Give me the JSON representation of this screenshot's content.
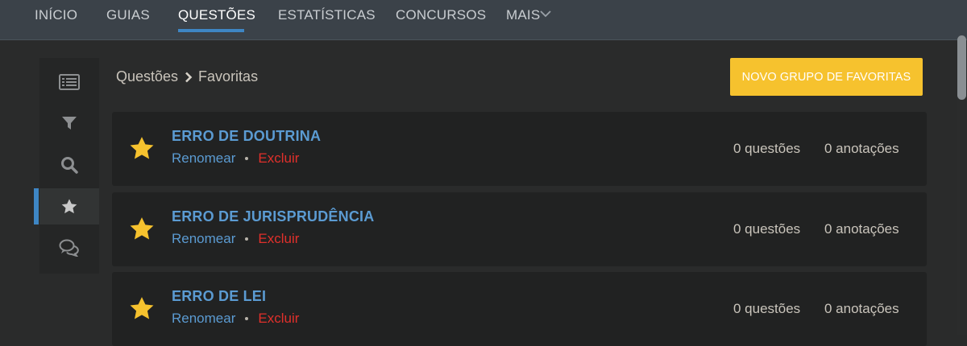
{
  "nav": {
    "items": [
      {
        "label": "INÍCIO"
      },
      {
        "label": "GUIAS"
      },
      {
        "label": "QUESTÕES"
      },
      {
        "label": "ESTATÍSTICAS"
      },
      {
        "label": "CONCURSOS"
      },
      {
        "label": "MAIS"
      }
    ],
    "active_index": 2
  },
  "sidebar": {
    "items": [
      {
        "icon": "list-icon"
      },
      {
        "icon": "filter-icon"
      },
      {
        "icon": "search-icon"
      },
      {
        "icon": "star-icon",
        "active": true
      },
      {
        "icon": "comments-icon"
      }
    ]
  },
  "breadcrumb": {
    "parent": "Questões",
    "current": "Favoritas"
  },
  "new_group_button": "NOVO GRUPO DE FAVORITAS",
  "groups": [
    {
      "title": "ERRO DE DOUTRINA",
      "rename": "Renomear",
      "delete": "Excluir",
      "questions": "0 questões",
      "notes": "0 anotações"
    },
    {
      "title": "ERRO DE JURISPRUDÊNCIA",
      "rename": "Renomear",
      "delete": "Excluir",
      "questions": "0 questões",
      "notes": "0 anotações"
    },
    {
      "title": "ERRO DE LEI",
      "rename": "Renomear",
      "delete": "Excluir",
      "questions": "0 questões",
      "notes": "0 anotações"
    }
  ],
  "colors": {
    "accent_blue": "#3e86c4",
    "link_blue": "#5b9bd2",
    "danger_red": "#e0302b",
    "button_yellow": "#f6c22e",
    "star_yellow": "#f6c22e"
  }
}
